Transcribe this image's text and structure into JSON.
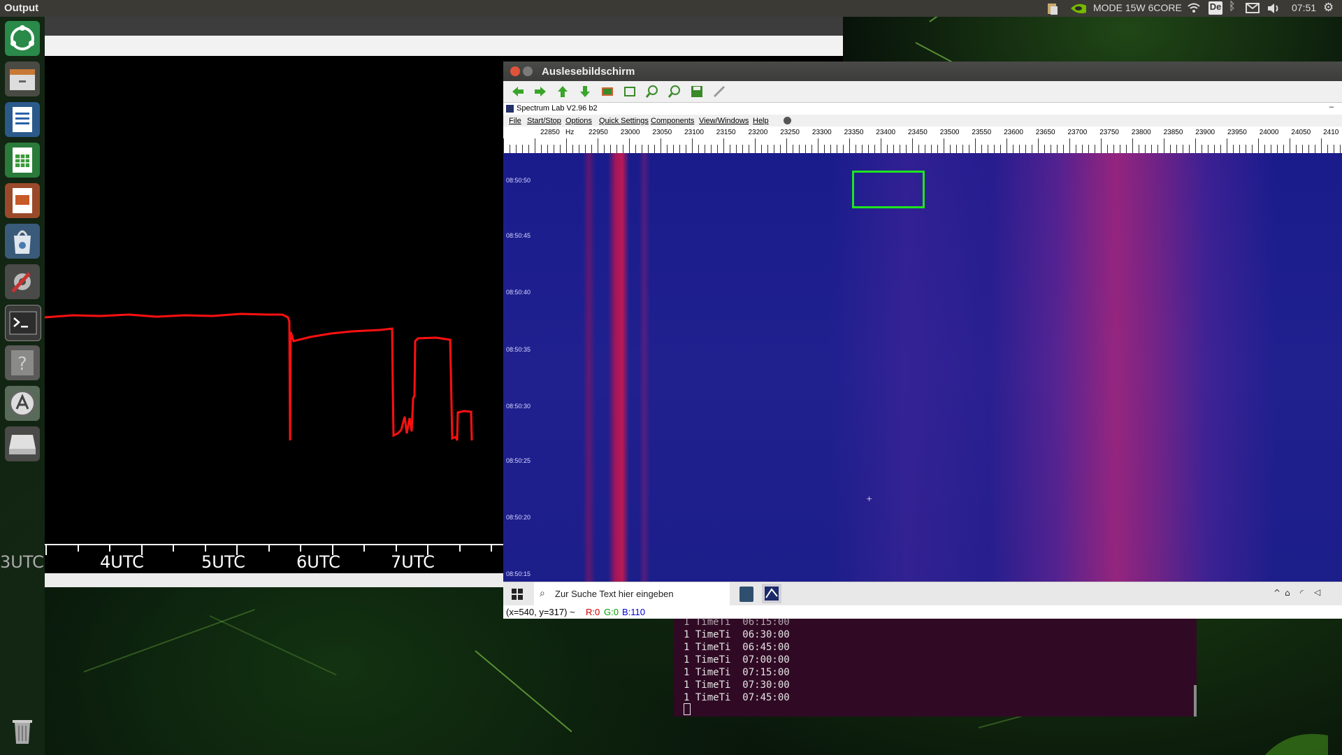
{
  "top_panel": {
    "app_title": "Output",
    "mode_text": "MODE 15W 6CORE",
    "keyboard_layout": "De",
    "clock": "07:51"
  },
  "output_window": {
    "time_axis_labels": [
      "3UTC",
      "4UTC",
      "5UTC",
      "6UTC",
      "7UTC"
    ],
    "trace_color": "#ff1010"
  },
  "spectrum_window": {
    "title": "Auslesebildschirm",
    "inner_title": "Spectrum Lab V2.96 b2",
    "menu": [
      "File",
      "Start/Stop",
      "Options",
      "Quick Settings",
      "Components",
      "View/Windows",
      "Help"
    ],
    "freq_unit": "Hz",
    "freq_labels": [
      "22850",
      "22950",
      "23000",
      "23050",
      "23100",
      "23150",
      "23200",
      "23250",
      "23300",
      "23350",
      "23400",
      "23450",
      "23500",
      "23550",
      "23600",
      "23650",
      "23700",
      "23750",
      "23800",
      "23850",
      "23900",
      "23950",
      "24000",
      "24050",
      "2410"
    ],
    "time_labels": [
      "08:50:50",
      "08:50:45",
      "08:50:40",
      "08:50:35",
      "08:50:30",
      "08:50:25",
      "08:50:20",
      "08:50:15"
    ],
    "taskbar_search_placeholder": "Zur Suche Text hier eingeben",
    "status": {
      "coords": "(x=540, y=317) ~ ",
      "r": "R:0",
      "g": "G:0",
      "b": "B:110"
    }
  },
  "terminal": {
    "lines": [
      "1 TimeTi  06:15:00",
      "1 TimeTi  06:30:00",
      "1 TimeTi  06:45:00",
      "1 TimeTi  07:00:00",
      "1 TimeTi  07:15:00",
      "1 TimeTi  07:30:00",
      "1 TimeTi  07:45:00"
    ]
  },
  "colors": {
    "accent_green": "#1ee61e",
    "terminal_bg": "#300a24",
    "waterfall_bg": "#1c1e8c"
  }
}
